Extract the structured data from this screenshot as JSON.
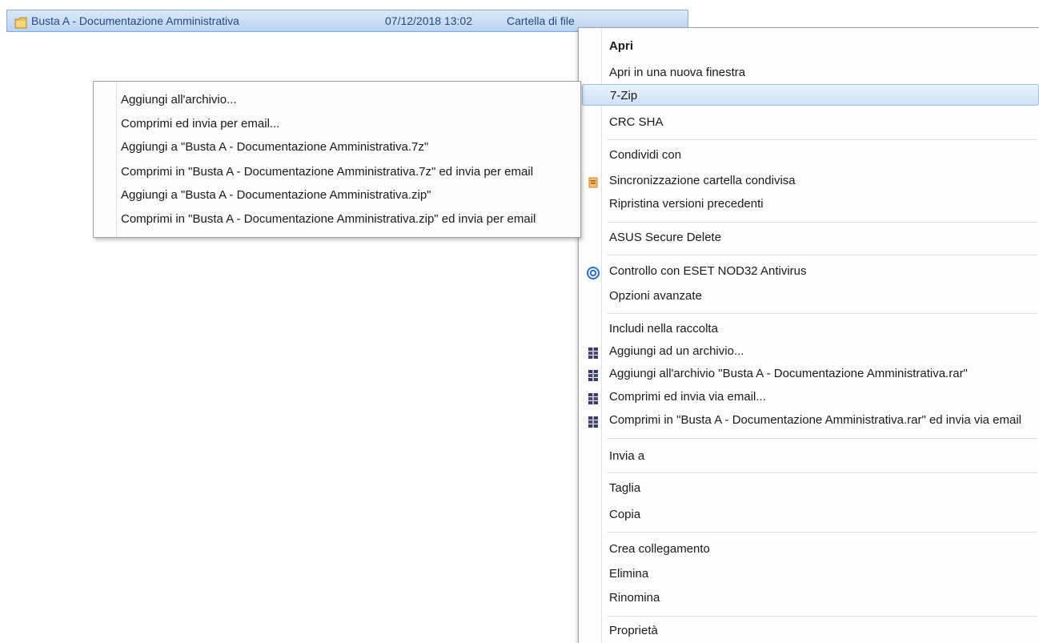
{
  "file_row": {
    "name": "Busta A - Documentazione Amministrativa",
    "date": "07/12/2018 13:02",
    "type": "Cartella di file"
  },
  "context_menu": {
    "items": [
      {
        "label": "Apri"
      },
      {
        "label": "Apri in una nuova finestra"
      },
      {
        "label": "7-Zip"
      },
      {
        "label": "CRC SHA"
      },
      {
        "label": "Condividi con"
      },
      {
        "label": "Sincronizzazione cartella condivisa",
        "icon": "sync-icon"
      },
      {
        "label": "Ripristina versioni precedenti"
      },
      {
        "label": "ASUS Secure Delete"
      },
      {
        "label": "Controllo con ESET NOD32 Antivirus",
        "icon": "eset-icon"
      },
      {
        "label": "Opzioni avanzate"
      },
      {
        "label": "Includi nella raccolta"
      },
      {
        "label": "Aggiungi ad un archivio...",
        "icon": "winrar-icon"
      },
      {
        "label": "Aggiungi all'archivio \"Busta A - Documentazione Amministrativa.rar\"",
        "icon": "winrar-icon"
      },
      {
        "label": "Comprimi ed invia via email...",
        "icon": "winrar-icon"
      },
      {
        "label": "Comprimi in \"Busta A - Documentazione Amministrativa.rar\" ed invia via email",
        "icon": "winrar-icon"
      },
      {
        "label": "Invia a"
      },
      {
        "label": "Taglia"
      },
      {
        "label": "Copia"
      },
      {
        "label": "Crea collegamento"
      },
      {
        "label": "Elimina"
      },
      {
        "label": "Rinomina"
      },
      {
        "label": "Proprietà"
      }
    ]
  },
  "zip_submenu": {
    "items": [
      {
        "label": "Aggiungi all'archivio..."
      },
      {
        "label": "Comprimi ed invia per email..."
      },
      {
        "label": "Aggiungi a \"Busta A - Documentazione Amministrativa.7z\""
      },
      {
        "label": "Comprimi in \"Busta A - Documentazione Amministrativa.7z\" ed invia per email"
      },
      {
        "label": "Aggiungi a \"Busta A - Documentazione Amministrativa.zip\""
      },
      {
        "label": "Comprimi in \"Busta A - Documentazione Amministrativa.zip\" ed invia per email"
      }
    ]
  },
  "colors": {
    "selection": "#c6dcf5",
    "selection_border": "#84acdd",
    "menu_text": "#1a1a1a"
  }
}
